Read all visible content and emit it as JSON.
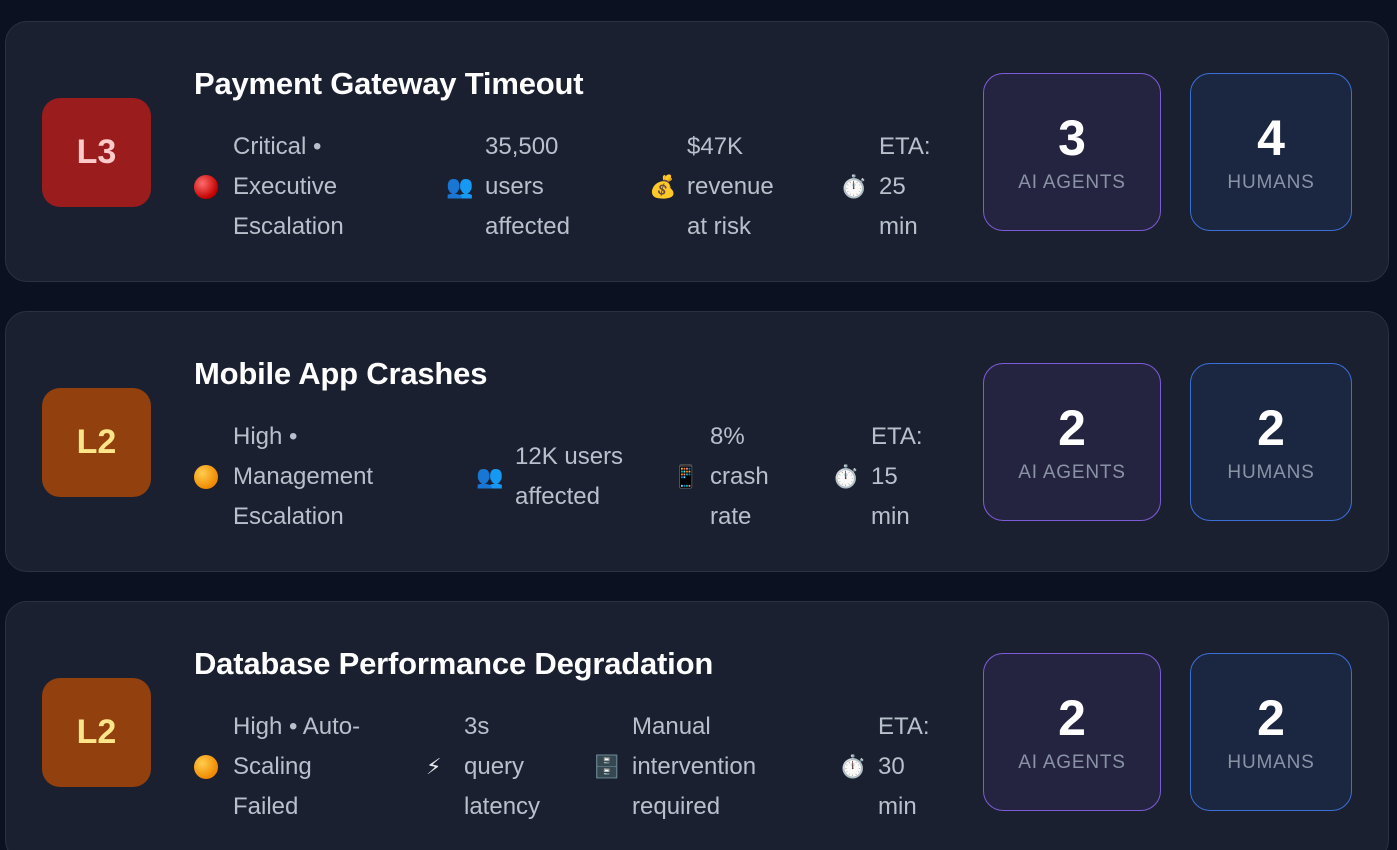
{
  "incidents": [
    {
      "level": "L3",
      "title": "Payment Gateway Timeout",
      "severity_icon": "red-circle",
      "severity": [
        "Critical •",
        "Executive",
        "Escalation"
      ],
      "impact_icon": "users-icon",
      "impact": [
        "35,500",
        "users",
        "affected"
      ],
      "metric_icon": "money-bag-icon",
      "metric": [
        "$47K",
        "revenue",
        "at risk"
      ],
      "eta_icon": "stopwatch-icon",
      "eta": [
        "ETA:",
        "25",
        "min"
      ],
      "ai_agents": "3",
      "ai_label": "AI AGENTS",
      "humans": "4",
      "humans_label": "HUMANS"
    },
    {
      "level": "L2",
      "title": "Mobile App Crashes",
      "severity_icon": "orange-circle",
      "severity": [
        "High •",
        "Management",
        "Escalation"
      ],
      "impact_icon": "users-icon",
      "impact": [
        "12K users",
        "affected"
      ],
      "metric_icon": "mobile-phone-icon",
      "metric": [
        "8%",
        "crash",
        "rate"
      ],
      "eta_icon": "stopwatch-icon",
      "eta": [
        "ETA:",
        "15",
        "min"
      ],
      "ai_agents": "2",
      "ai_label": "AI AGENTS",
      "humans": "2",
      "humans_label": "HUMANS"
    },
    {
      "level": "L2",
      "title": "Database Performance Degradation",
      "severity_icon": "orange-circle",
      "severity": [
        "High • Auto-",
        "Scaling",
        "Failed"
      ],
      "impact_icon": "lightning-icon",
      "impact": [
        "3s",
        "query",
        "latency"
      ],
      "metric_icon": "file-cabinet-icon",
      "metric": [
        "Manual",
        "intervention",
        "required"
      ],
      "eta_icon": "stopwatch-icon",
      "eta": [
        "ETA:",
        "30",
        "min"
      ],
      "ai_agents": "2",
      "ai_label": "AI AGENTS",
      "humans": "2",
      "humans_label": "HUMANS"
    }
  ]
}
